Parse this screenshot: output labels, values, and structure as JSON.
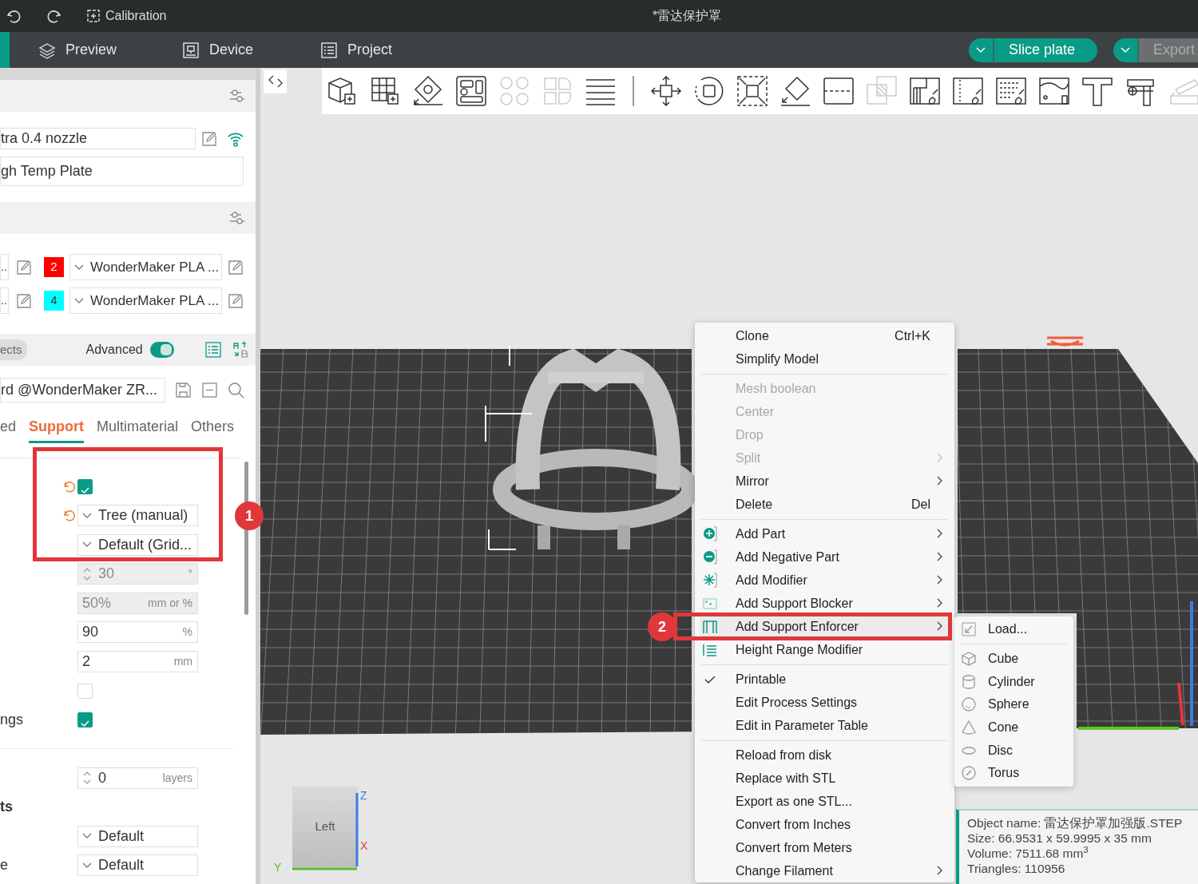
{
  "title_bar": {
    "calibration_label": "Calibration",
    "title": "*雷达保护罩"
  },
  "nav": {
    "tabs": [
      {
        "label": "Preview",
        "selected": false
      },
      {
        "label": "Device",
        "selected": false
      },
      {
        "label": "Project",
        "selected": false
      }
    ],
    "slice_label": "Slice plate",
    "export": {
      "label": "Export",
      "disabled": true
    }
  },
  "sidebar": {
    "printer": "tra 0.4 nozzle",
    "plate": "gh Temp Plate",
    "filaments": [
      {
        "value": "..",
        "number": "2",
        "color": "#ff0000",
        "preset": "WonderMaker PLA ..."
      },
      {
        "value": "..",
        "number": "4",
        "color": "#00ffff",
        "preset": "WonderMaker PLA ..."
      }
    ],
    "process": {
      "objects_label": "ects",
      "advanced_label": "Advanced",
      "advanced_on": true,
      "preset": "rd @WonderMaker ZR..."
    },
    "tabs": [
      {
        "label": "ed",
        "selected": false
      },
      {
        "label": "Support",
        "selected": true
      },
      {
        "label": "Multimaterial",
        "selected": false
      },
      {
        "label": "Others",
        "selected": false
      }
    ],
    "settings": [
      {
        "kind": "checkbox",
        "checked": true,
        "reset": true
      },
      {
        "kind": "dropdown",
        "value": "Tree (manual)",
        "reset": true
      },
      {
        "kind": "dropdown",
        "value": "Default (Grid...",
        "reset": false
      },
      {
        "kind": "spin",
        "value": "30",
        "unit": "°",
        "disabled": true
      },
      {
        "kind": "input",
        "value": "50%",
        "unit": "mm or %",
        "disabled": true
      },
      {
        "kind": "input",
        "value": "90",
        "unit": "%",
        "disabled": false
      },
      {
        "kind": "input",
        "value": "2",
        "unit": "mm",
        "disabled": false
      },
      {
        "kind": "checkbox",
        "checked": false,
        "reset": false
      },
      {
        "kind": "checkbox",
        "label": "ngs",
        "checked": true,
        "reset": false
      },
      {
        "kind": "divider"
      },
      {
        "kind": "spin",
        "value": "0",
        "unit": "layers",
        "disabled": false
      },
      {
        "kind": "heading",
        "label": "ts"
      },
      {
        "kind": "dropdown",
        "value": "Default",
        "reset": false
      },
      {
        "kind": "dropdown",
        "label": "e",
        "value": "Default",
        "reset": false
      }
    ]
  },
  "toolbar": [
    {
      "disabled": false
    },
    {
      "disabled": false
    },
    {
      "disabled": false
    },
    {
      "disabled": false
    },
    {
      "disabled": true
    },
    {
      "disabled": true
    },
    {
      "disabled": false
    },
    {
      "disabled": false
    },
    {
      "disabled": false
    },
    {
      "disabled": false
    },
    {
      "disabled": false
    },
    {
      "disabled": false
    },
    {
      "disabled": true
    },
    {
      "disabled": false
    },
    {
      "disabled": false
    },
    {
      "disabled": false
    },
    {
      "disabled": false
    },
    {
      "disabled": false
    },
    {
      "disabled": false
    },
    {
      "disabled": true
    }
  ],
  "context_menu": [
    {
      "kind": "item",
      "label": "Clone",
      "shortcut": "Ctrl+K",
      "disabled": false,
      "submenu": false,
      "checked": false,
      "selected": false
    },
    {
      "kind": "item",
      "label": "Simplify Model",
      "disabled": false,
      "submenu": false,
      "checked": false,
      "selected": false
    },
    {
      "kind": "separator"
    },
    {
      "kind": "item",
      "label": "Mesh boolean",
      "disabled": true,
      "submenu": false,
      "checked": false,
      "selected": false
    },
    {
      "kind": "item",
      "label": "Center",
      "disabled": true,
      "submenu": false,
      "checked": false,
      "selected": false
    },
    {
      "kind": "item",
      "label": "Drop",
      "disabled": true,
      "submenu": false,
      "checked": false,
      "selected": false
    },
    {
      "kind": "item",
      "label": "Split",
      "disabled": true,
      "submenu": true,
      "checked": false,
      "selected": false
    },
    {
      "kind": "item",
      "label": "Mirror",
      "disabled": false,
      "submenu": true,
      "checked": false,
      "selected": false
    },
    {
      "kind": "item",
      "label": "Delete",
      "shortcut": "Del",
      "disabled": false,
      "submenu": false,
      "checked": false,
      "selected": false
    },
    {
      "kind": "separator"
    },
    {
      "kind": "item",
      "label": "Add Part",
      "disabled": false,
      "submenu": true,
      "checked": false,
      "selected": false
    },
    {
      "kind": "item",
      "label": "Add Negative Part",
      "disabled": false,
      "submenu": true,
      "checked": false,
      "selected": false
    },
    {
      "kind": "item",
      "label": "Add Modifier",
      "disabled": false,
      "submenu": true,
      "checked": false,
      "selected": false
    },
    {
      "kind": "item",
      "label": "Add Support Blocker",
      "disabled": false,
      "submenu": true,
      "checked": false,
      "selected": false
    },
    {
      "kind": "item",
      "label": "Add Support Enforcer",
      "disabled": false,
      "submenu": true,
      "checked": false,
      "selected": true
    },
    {
      "kind": "item",
      "label": "Height Range Modifier",
      "disabled": false,
      "submenu": false,
      "checked": false,
      "selected": false
    },
    {
      "kind": "separator"
    },
    {
      "kind": "item",
      "label": "Printable",
      "disabled": false,
      "submenu": false,
      "checked": true,
      "selected": false
    },
    {
      "kind": "item",
      "label": "Edit Process Settings",
      "disabled": false,
      "submenu": false,
      "checked": false,
      "selected": false
    },
    {
      "kind": "item",
      "label": "Edit in Parameter Table",
      "disabled": false,
      "submenu": false,
      "checked": false,
      "selected": false
    },
    {
      "kind": "separator"
    },
    {
      "kind": "item",
      "label": "Reload from disk",
      "disabled": false,
      "submenu": false,
      "checked": false,
      "selected": false
    },
    {
      "kind": "item",
      "label": "Replace with STL",
      "disabled": false,
      "submenu": false,
      "checked": false,
      "selected": false
    },
    {
      "kind": "item",
      "label": "Export as one STL...",
      "disabled": false,
      "submenu": false,
      "checked": false,
      "selected": false
    },
    {
      "kind": "item",
      "label": "Convert from Inches",
      "disabled": false,
      "submenu": false,
      "checked": false,
      "selected": false
    },
    {
      "kind": "item",
      "label": "Convert from Meters",
      "disabled": false,
      "submenu": false,
      "checked": false,
      "selected": false
    },
    {
      "kind": "item",
      "label": "Change Filament",
      "disabled": false,
      "submenu": true,
      "checked": false,
      "selected": false
    }
  ],
  "submenu": [
    {
      "kind": "item",
      "label": "Load..."
    },
    {
      "kind": "separator"
    },
    {
      "kind": "item",
      "label": "Cube"
    },
    {
      "kind": "item",
      "label": "Cylinder"
    },
    {
      "kind": "item",
      "label": "Sphere"
    },
    {
      "kind": "item",
      "label": "Cone"
    },
    {
      "kind": "item",
      "label": "Disc"
    },
    {
      "kind": "item",
      "label": "Torus"
    }
  ],
  "object_info": [
    "Object name: 雷达保护罩加强版.STEP",
    "Size: 66.9531 x 59.9995 x 35 mm",
    "Volume: 7511.68 mm$^{3}$",
    "Triangles: 110956"
  ],
  "view_cube": {
    "face": "Left",
    "axes": [
      {
        "label": "Z",
        "color": "#3b7ddd"
      },
      {
        "label": "X",
        "color": "#e0383e"
      },
      {
        "label": "Y",
        "color": "#5cb82e"
      }
    ]
  },
  "annotations": [
    {
      "label": "1"
    },
    {
      "label": "2"
    }
  ]
}
